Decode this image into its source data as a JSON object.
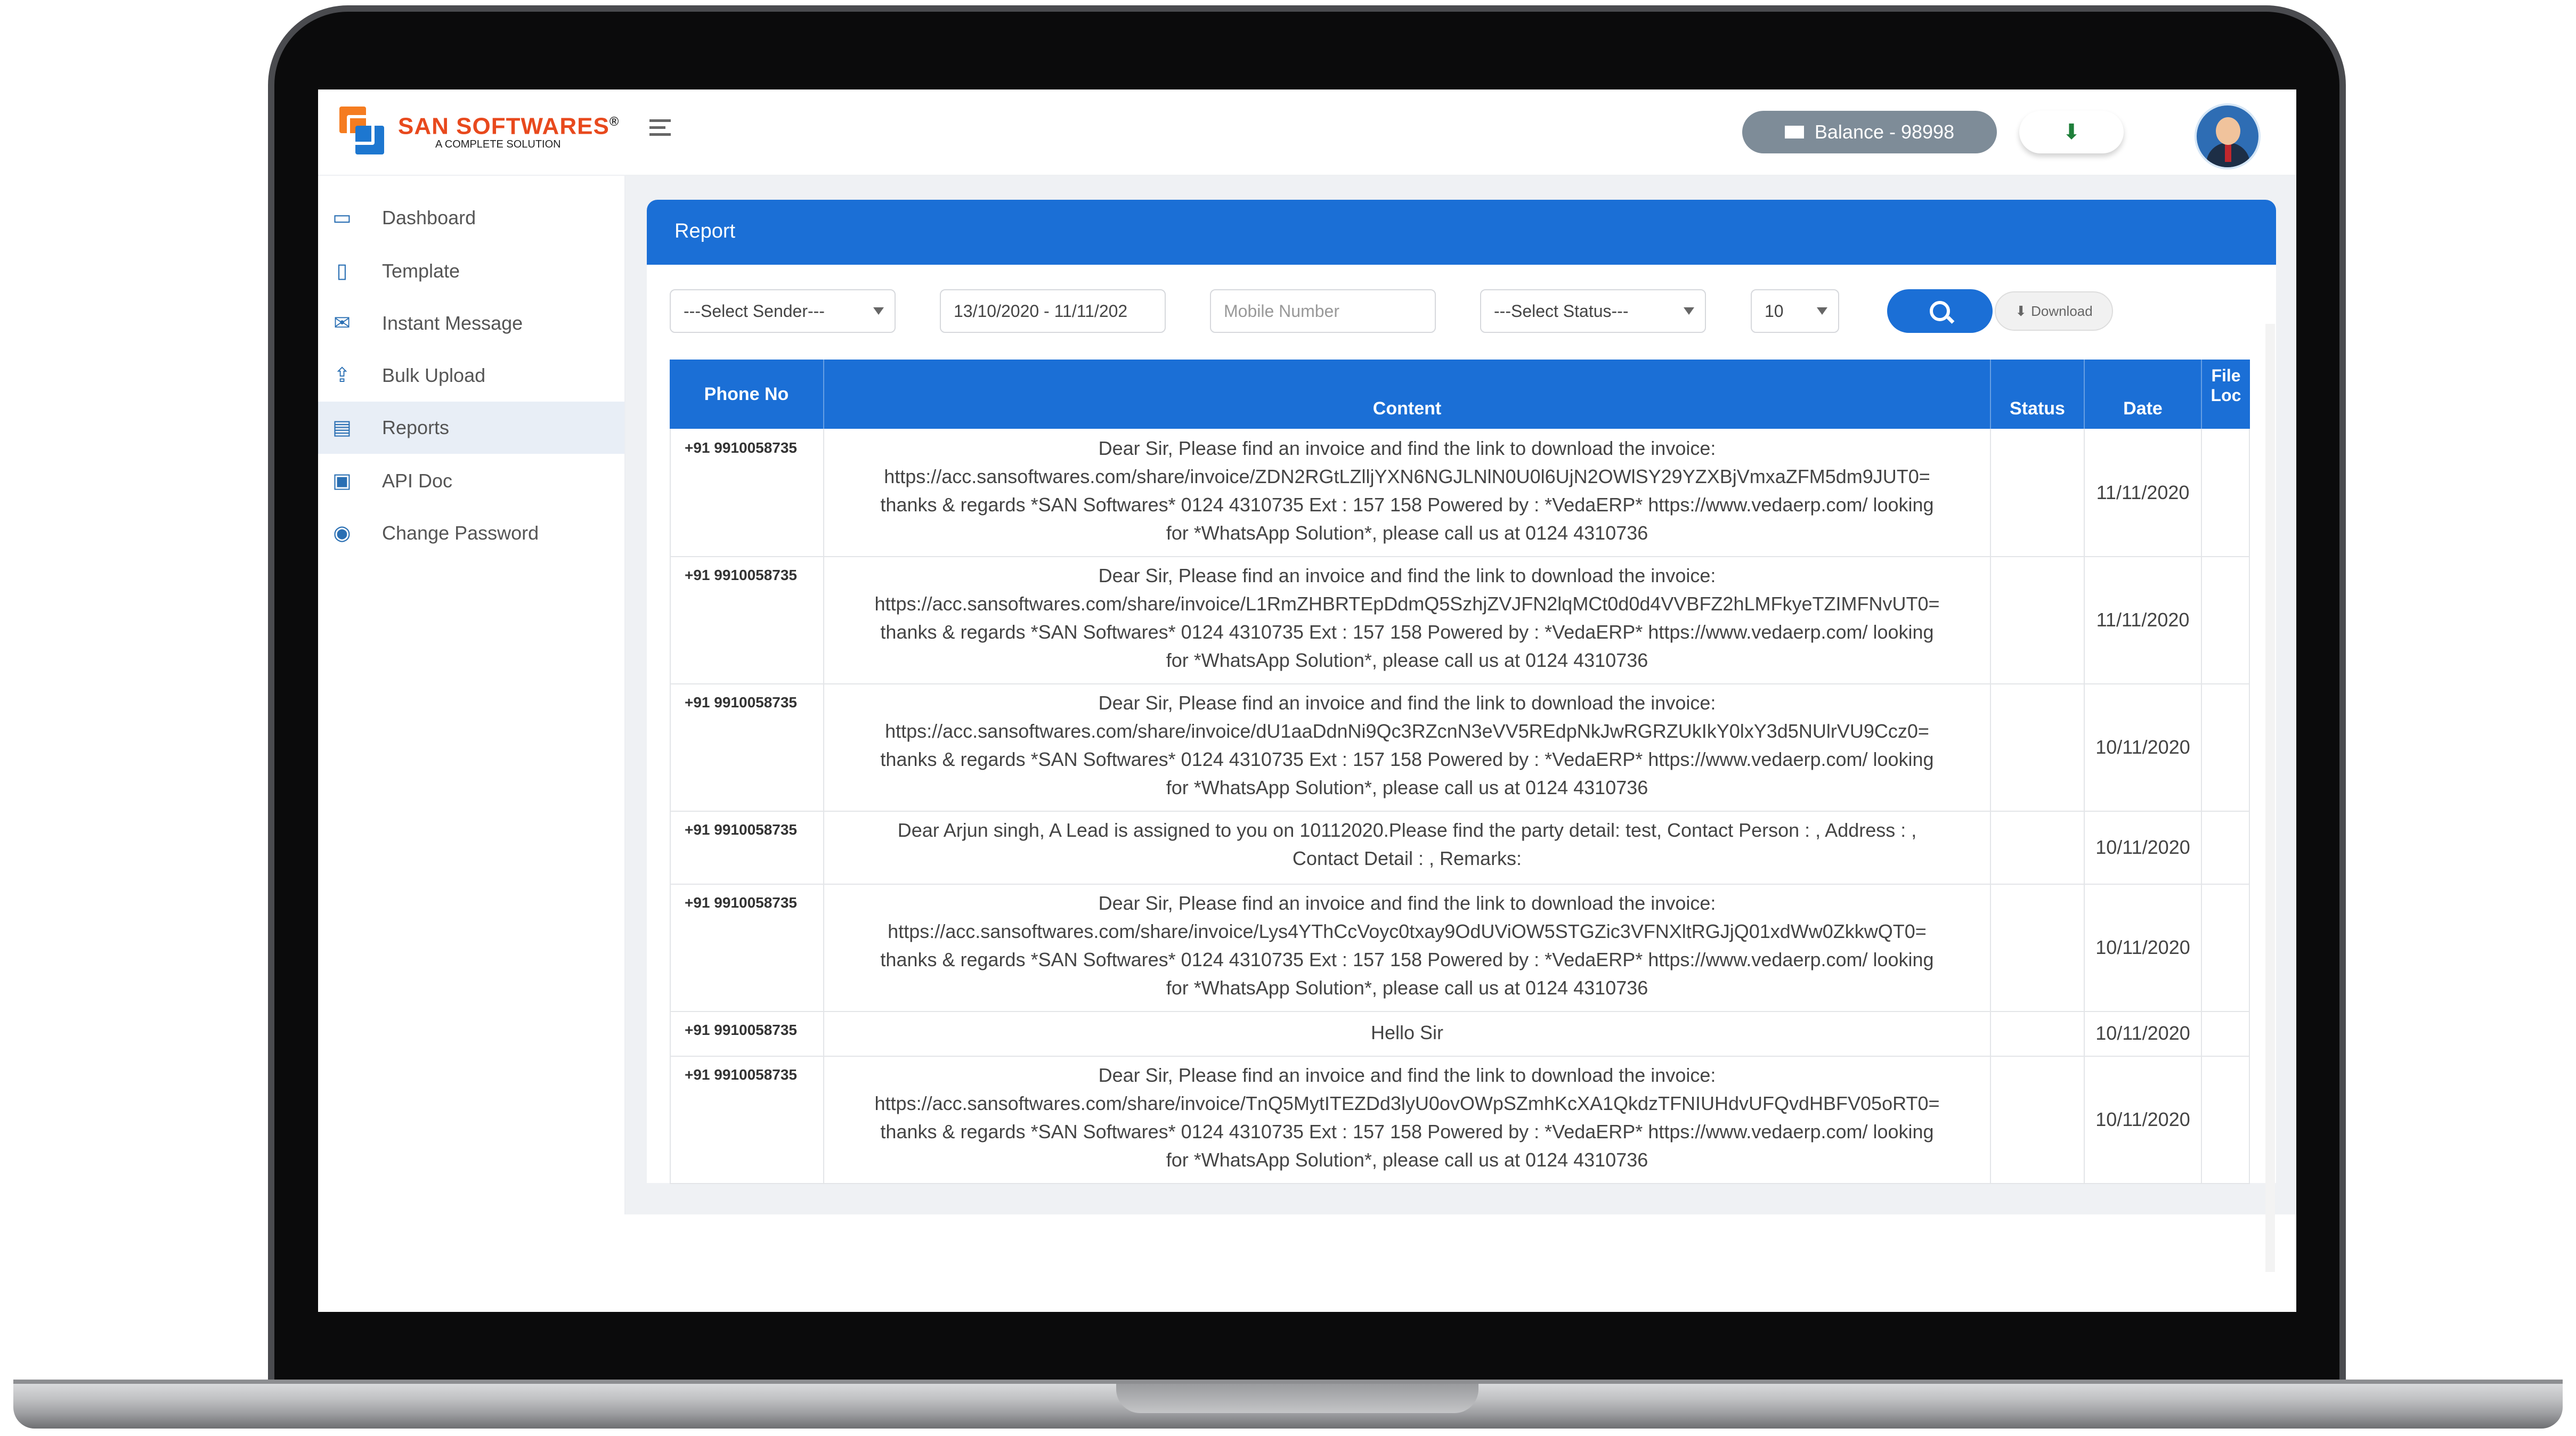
{
  "app": {
    "logo_title": "SAN SOFTWARES",
    "logo_reg": "®",
    "logo_subtitle": "A COMPLETE SOLUTION",
    "balance_label": "Balance - 98998",
    "download_icon": "download-icon"
  },
  "sidebar": {
    "items": [
      {
        "label": "Dashboard",
        "icon": "monitor-icon"
      },
      {
        "label": "Template",
        "icon": "document-icon"
      },
      {
        "label": "Instant Message",
        "icon": "envelope-icon"
      },
      {
        "label": "Bulk Upload",
        "icon": "upload-icon"
      },
      {
        "label": "Reports",
        "icon": "report-icon",
        "active": true
      },
      {
        "label": "API Doc",
        "icon": "api-icon"
      },
      {
        "label": "Change Password",
        "icon": "lock-icon"
      }
    ]
  },
  "report": {
    "title": "Report",
    "filters": {
      "sender": "---Select Sender---",
      "date_range": "13/10/2020 - 11/11/202",
      "mobile_placeholder": "Mobile Number",
      "status": "---Select Status---",
      "page_size": "10"
    },
    "download_label": "Download",
    "columns": {
      "phone": "Phone No",
      "content": "Content",
      "status": "Status",
      "date": "Date",
      "file_loc_1": "File",
      "file_loc_2": "Loc"
    },
    "rows": [
      {
        "phone": "+91 9910058735",
        "date": "11/11/2020",
        "status": "",
        "lines": [
          "Dear Sir, Please find an invoice and find the link to download the invoice:",
          "https://acc.sansoftwares.com/share/invoice/ZDN2RGtLZlljYXN6NGJLNlN0U0l6UjN2OWlSY29YZXBjVmxaZFM5dm9JUT0=",
          "thanks & regards *SAN Softwares* 0124 4310735 Ext : 157 158 Powered by : *VedaERP* https://www.vedaerp.com/ looking",
          "for *WhatsApp Solution*, please call us at 0124 4310736"
        ]
      },
      {
        "phone": "+91 9910058735",
        "date": "11/11/2020",
        "status": "",
        "lines": [
          "Dear Sir, Please find an invoice and find the link to download the invoice:",
          "https://acc.sansoftwares.com/share/invoice/L1RmZHBRTEpDdmQ5SzhjZVJFN2lqMCt0d0d4VVBFZ2hLMFkyeTZIMFNvUT0=",
          "thanks & regards *SAN Softwares* 0124 4310735 Ext : 157 158 Powered by : *VedaERP* https://www.vedaerp.com/ looking",
          "for *WhatsApp Solution*, please call us at 0124 4310736"
        ]
      },
      {
        "phone": "+91 9910058735",
        "date": "10/11/2020",
        "status": "",
        "lines": [
          "Dear Sir, Please find an invoice and find the link to download the invoice:",
          "https://acc.sansoftwares.com/share/invoice/dU1aaDdnNi9Qc3RZcnN3eVV5REdpNkJwRGRZUkIkY0lxY3d5NUlrVU9Ccz0=",
          "thanks & regards *SAN Softwares* 0124 4310735 Ext : 157 158 Powered by : *VedaERP* https://www.vedaerp.com/ looking",
          "for *WhatsApp Solution*, please call us at 0124 4310736"
        ]
      },
      {
        "phone": "+91 9910058735",
        "date": "10/11/2020",
        "status": "",
        "lines": [
          "Dear Arjun singh, A Lead is assigned to you on 10112020.Please find the party detail: test, Contact Person : , Address : ,",
          "Contact Detail : , Remarks:"
        ]
      },
      {
        "phone": "+91 9910058735",
        "date": "10/11/2020",
        "status": "",
        "lines": [
          "Dear Sir, Please find an invoice and find the link to download the invoice:",
          "https://acc.sansoftwares.com/share/invoice/Lys4YThCcVoyc0txay9OdUViOW5STGZic3VFNXltRGJjQ01xdWw0ZkkwQT0=",
          "thanks & regards *SAN Softwares* 0124 4310735 Ext : 157 158 Powered by : *VedaERP* https://www.vedaerp.com/ looking",
          "for *WhatsApp Solution*, please call us at 0124 4310736"
        ]
      },
      {
        "phone": "+91 9910058735",
        "date": "10/11/2020",
        "status": "",
        "lines": [
          "Hello Sir"
        ]
      },
      {
        "phone": "+91 9910058735",
        "date": "10/11/2020",
        "status": "",
        "lines": [
          "Dear Sir, Please find an invoice and find the link to download the invoice:",
          "https://acc.sansoftwares.com/share/invoice/TnQ5MytITEZDd3lyU0ovOWpSZmhKcXA1QkdzTFNIUHdvUFQvdHBFV05oRT0=",
          "thanks & regards *SAN Softwares* 0124 4310735 Ext : 157 158 Powered by : *VedaERP* https://www.vedaerp.com/ looking",
          "for *WhatsApp Solution*, please call us at 0124 4310736"
        ]
      }
    ]
  }
}
